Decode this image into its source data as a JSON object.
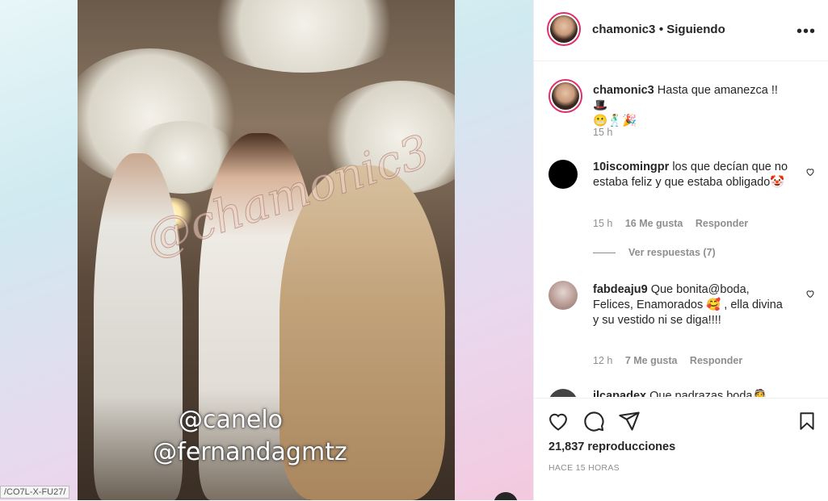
{
  "post": {
    "username": "chamonic3",
    "follow_status": "Siguiendo",
    "more_label": "•••",
    "url_fragment": "/CO7L-X-FU27/",
    "video": {
      "watermark": "@chamonic3",
      "tag_1": "@canelo",
      "tag_2": "@fernandagmtz"
    }
  },
  "caption": {
    "username": "chamonic3",
    "text": "Hasta que amanezca !! 🎩",
    "emojis": "😬🕺🎉",
    "time": "15 h"
  },
  "comments": [
    {
      "username": "10iscomingpr",
      "text": "los que decían que no estaba feliz y que estaba obligado🤡",
      "time": "15 h",
      "likes": "16 Me gusta",
      "reply": "Responder"
    },
    {
      "username": "fabdeaju9",
      "text": "Que bonita@boda, Felices, Enamorados 🥰 , ella divina y su vestido ni se diga!!!!",
      "time": "12 h",
      "likes": "7 Me gusta",
      "reply": "Responder"
    },
    {
      "username": "jlcapadex",
      "text": "Que padrazas boda👰"
    }
  ],
  "view_replies": "Ver respuestas (7)",
  "footer": {
    "views": "21,837 reproducciones",
    "time_ago": "HACE 15 HORAS"
  },
  "icons": [
    "heart-icon",
    "comment-icon",
    "share-icon",
    "bookmark-icon",
    "more-icon"
  ]
}
